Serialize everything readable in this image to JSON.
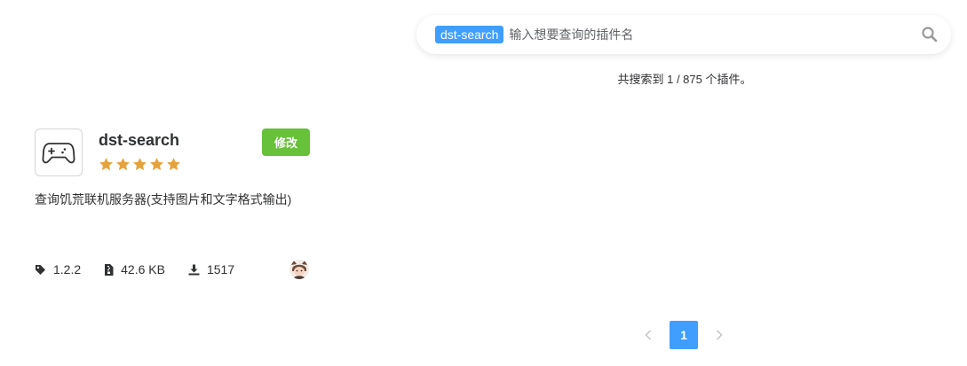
{
  "search": {
    "tag": "dst-search",
    "placeholder": "输入想要查询的插件名",
    "result_text": "共搜索到 1 / 875 个插件。"
  },
  "plugin": {
    "name": "dst-search",
    "rating": 5,
    "edit_label": "修改",
    "description": "查询饥荒联机服务器(支持图片和文字格式输出)",
    "version": "1.2.2",
    "size": "42.6 KB",
    "downloads": "1517",
    "icon": "gamepad-icon"
  },
  "pagination": {
    "current": "1",
    "prev_icon": "chevron-left-icon",
    "next_icon": "chevron-right-icon"
  },
  "colors": {
    "primary": "#409eff",
    "success": "#67c23a",
    "star": "#e6a23c"
  }
}
